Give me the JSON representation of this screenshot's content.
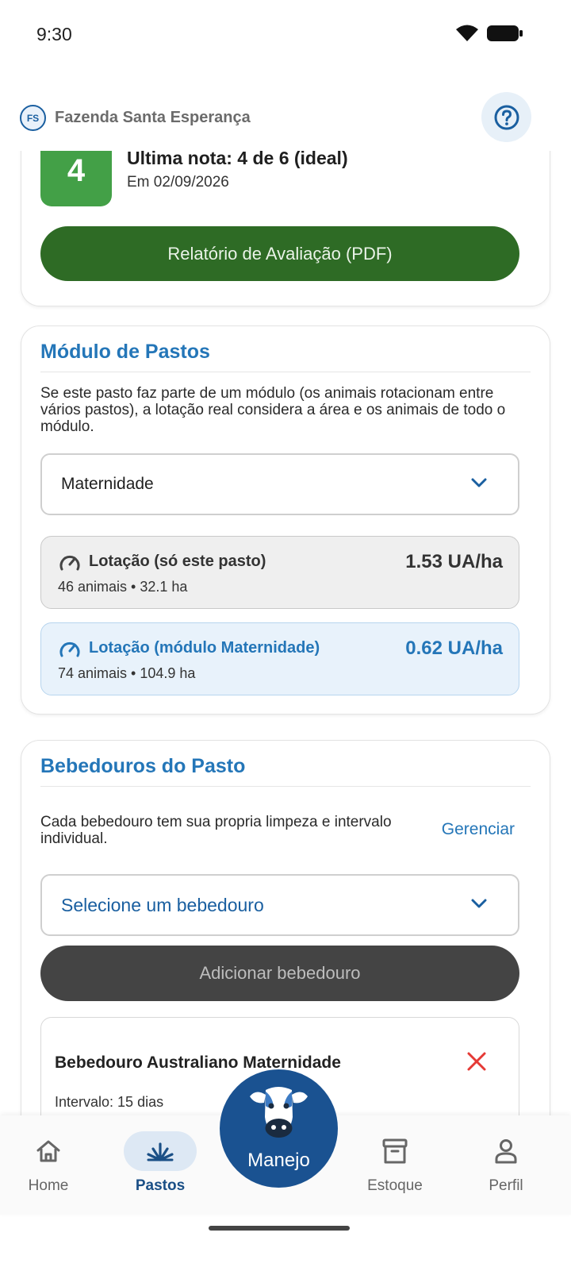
{
  "status": {
    "time": "9:30"
  },
  "header": {
    "farm_initials": "FS",
    "farm_name": "Fazenda Santa Esperança"
  },
  "evaluation": {
    "score": "4",
    "title": "Última nota: 4 de 6 (ideal)",
    "date": "Em 02/09/2026",
    "pdf_button": "Relatório de Avaliação (PDF)"
  },
  "module": {
    "title": "Módulo de Pastos",
    "description": "Se este pasto faz parte de um módulo (os animais rotacionam entre vários pastos), a lotação real considera a área e os animais de todo o módulo.",
    "selected": "Maternidade",
    "stock_single": {
      "label": "Lotação (só este pasto)",
      "sub": "46 animais • 32.1 ha",
      "value": "1.53 UA/ha"
    },
    "stock_module": {
      "label": "Lotação (módulo Maternidade)",
      "sub": "74 animais • 104.9 ha",
      "value": "0.62 UA/ha"
    }
  },
  "waterers": {
    "title": "Bebedouros do Pasto",
    "description": "Cada bebedouro tem sua propria limpeza e intervalo individual.",
    "manage_link": "Gerenciar",
    "select_placeholder": "Selecione um bebedouro",
    "add_button": "Adicionar bebedouro",
    "items": [
      {
        "name": "Bebedouro Australiano Maternidade",
        "interval": "Intervalo: 15 dias"
      }
    ]
  },
  "nav": {
    "home": "Home",
    "pastos": "Pastos",
    "manejo": "Manejo",
    "estoque": "Estoque",
    "perfil": "Perfil",
    "active": "pastos"
  },
  "colors": {
    "primary_blue": "#1a5291",
    "title_blue": "#2476b8",
    "green_button": "#2e6b25",
    "score_green": "#43a047",
    "remove_red": "#e53935"
  }
}
